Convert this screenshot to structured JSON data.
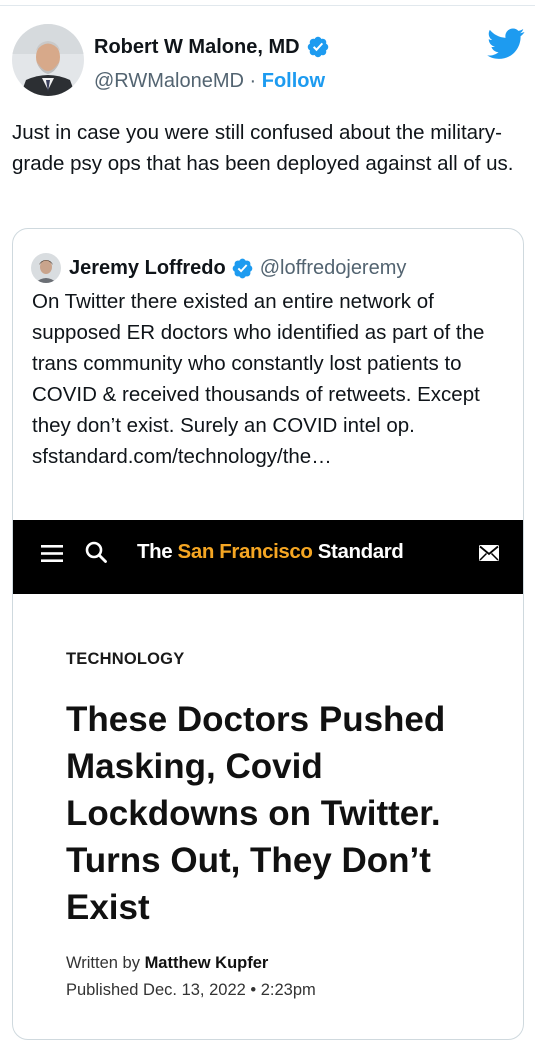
{
  "tweet": {
    "author_name": "Robert W Malone, MD",
    "handle": "@RWMaloneMD",
    "separator": " · ",
    "follow_label": "Follow",
    "text": "Just in case you were still confused about the military-grade psy ops that has been deployed against all of us."
  },
  "quoted_tweet": {
    "author_name": "Jeremy Loffredo",
    "handle": "@loffredojeremy",
    "text": "On Twitter there existed an entire network of supposed ER doctors who identified as part of the trans community who constantly lost patients to COVID & received thousands of retweets. Except they don’t exist. Surely an COVID intel op.",
    "link": "sfstandard.com/technology/the…"
  },
  "article_card": {
    "masthead_prefix": "The ",
    "masthead_highlight": "San Francisco",
    "masthead_suffix": " Standard",
    "section": "TECHNOLOGY",
    "headline": "These Doctors Pushed Masking, Covid Lockdowns on Twitter. Turns Out, They Don’t Exist",
    "written_by_label": "Written by ",
    "author": "Matthew Kupfer",
    "published": "Published Dec. 13, 2022 • 2:23pm"
  },
  "colors": {
    "twitter_blue": "#1d9bf0",
    "sf_orange": "#f5a623",
    "text": "#0f1419",
    "muted": "#536471"
  },
  "icons": [
    "verified-badge-icon",
    "twitter-bird-icon",
    "hamburger-menu-icon",
    "search-icon",
    "mail-icon"
  ]
}
